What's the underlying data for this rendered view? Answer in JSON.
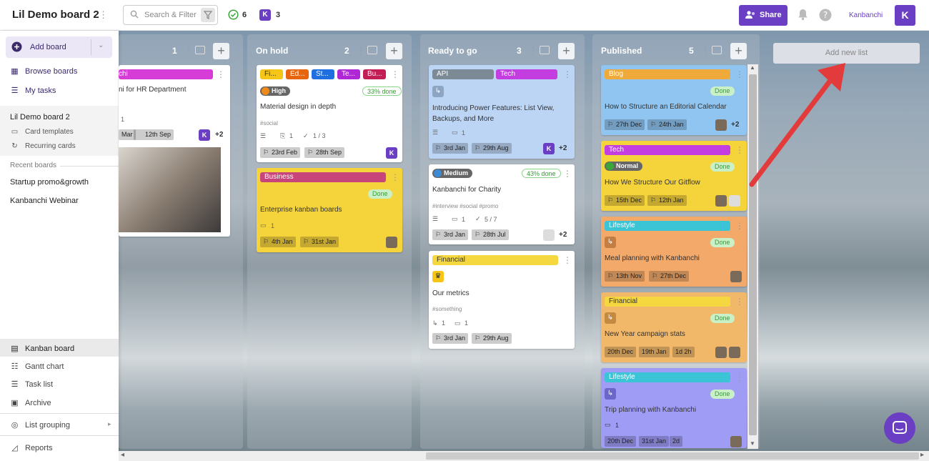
{
  "header": {
    "board_title": "Lil Demo board 2",
    "search_placeholder": "Search & Filter",
    "tasks_count": "6",
    "members_count": "3",
    "member_initial": "K",
    "share_label": "Share",
    "account_name": "Kanbanchi",
    "avatar_initial": "K"
  },
  "sidebar": {
    "add_board": "Add board",
    "browse_boards": "Browse boards",
    "my_tasks": "My tasks",
    "current_board": "Lil Demo board 2",
    "card_templates": "Card templates",
    "recurring_cards": "Recurring cards",
    "recent_boards_label": "Recent boards",
    "recent_boards": [
      "Startup promo&growth",
      "Kanbanchi Webinar"
    ],
    "views": [
      "Kanban board",
      "Gantt chart",
      "Task list",
      "Archive"
    ],
    "list_grouping": "List grouping",
    "reports": "Reports"
  },
  "colors": {
    "accent": "#6b3fc4",
    "yellow_card": "#f5d33b",
    "blue_card": "#bcd5f5",
    "orange_card": "#f2a96a",
    "purple_card": "#9f9cf5"
  },
  "lists": [
    {
      "title": "",
      "count": "1",
      "card": {
        "title_fragment": "chi",
        "title": "ni for HR Department",
        "comments": "1",
        "date1": "Mar",
        "date2": "12th Sep",
        "more": "+2"
      }
    },
    {
      "title": "On hold",
      "count": "2",
      "cards": [
        {
          "tags": [
            "Fi...",
            "Ed...",
            "St...",
            "Te...",
            "Bu..."
          ],
          "priority": "High",
          "progress": "33% done",
          "title": "Material design in depth",
          "hashtags": "#social",
          "attachments": "1",
          "checklist": "1 / 3",
          "date1": "23rd Feb",
          "date2": "28th Sep",
          "avatar": "K"
        },
        {
          "tag": "Business",
          "status": "Done",
          "title": "Enterprise kanban boards",
          "comments": "1",
          "date1": "4th Jan",
          "date2": "31st Jan"
        }
      ]
    },
    {
      "title": "Ready to go",
      "count": "3",
      "cards": [
        {
          "tags": [
            "API",
            "Tech"
          ],
          "title": "Introducing Power Features: List View, Backups, and More",
          "comments": "1",
          "date1": "3rd Jan",
          "date2": "29th Aug",
          "avatar": "K",
          "more": "+2"
        },
        {
          "priority": "Medium",
          "progress": "43% done",
          "title": "Kanbanchi for Charity",
          "hashtags": "#interview #social #promo",
          "comments": "1",
          "checklist": "5 / 7",
          "date1": "3rd Jan",
          "date2": "28th Jul",
          "more": "+2"
        },
        {
          "tag": "Financial",
          "title": "Our metrics",
          "hashtags": "#something",
          "subcards": "1",
          "comments": "1",
          "date1": "3rd Jan",
          "date2": "29th Aug"
        }
      ]
    },
    {
      "title": "Published",
      "count": "5",
      "cards": [
        {
          "tag": "Blog",
          "status": "Done",
          "title": "How to Structure an Editorial Calendar",
          "date1": "27th Dec",
          "date2": "24th Jan",
          "more": "+2"
        },
        {
          "tag": "Tech",
          "priority": "Normal",
          "status": "Done",
          "title": "How We Structure Our Gitflow",
          "date1": "15th Dec",
          "date2": "12th Jan"
        },
        {
          "tag": "Lifestyle",
          "status": "Done",
          "title": "Meal planning with Kanbanchi",
          "date1": "13th Nov",
          "date2": "27th Dec"
        },
        {
          "tag": "Financial",
          "status": "Done",
          "title": "New Year campaign stats",
          "date1": "20th Dec",
          "date2": "19th Jan",
          "date3": "1d 2h"
        },
        {
          "tag": "Lifestyle",
          "status": "Done",
          "title": "Trip planning with Kanbanchi",
          "comments": "1",
          "date1": "20th Dec",
          "date2": "31st Jan",
          "date3": "2d"
        }
      ]
    }
  ],
  "add_new_list": "Add new list"
}
